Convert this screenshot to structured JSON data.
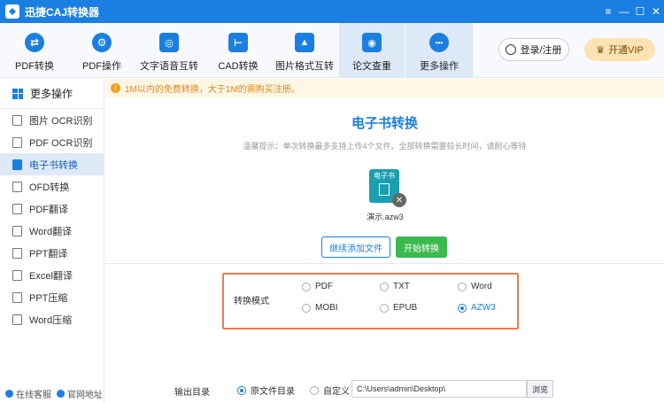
{
  "app": {
    "title": "迅捷CAJ转换器"
  },
  "window_controls": [
    "≡",
    "—",
    "☐",
    "✕"
  ],
  "toolbar": {
    "items": [
      {
        "label": "PDF转换",
        "icon": "pdf-convert-icon",
        "glyph": "⇄"
      },
      {
        "label": "PDF操作",
        "icon": "pdf-operation-icon",
        "glyph": "⚙"
      },
      {
        "label": "文字语音互转",
        "icon": "text-speech-icon",
        "glyph": "◎"
      },
      {
        "label": "CAD转换",
        "icon": "cad-convert-icon",
        "glyph": "⊢"
      },
      {
        "label": "图片格式互转",
        "icon": "image-format-icon",
        "glyph": "▲"
      },
      {
        "label": "论文查重",
        "icon": "paper-check-icon",
        "glyph": "◉"
      },
      {
        "label": "更多操作",
        "icon": "more-ops-icon",
        "glyph": "•••"
      }
    ],
    "active_index": 5,
    "login_label": "登录/注册",
    "vip_label": "开通VIP"
  },
  "sidebar": {
    "header": "更多操作",
    "items": [
      {
        "label": "图片 OCR识别"
      },
      {
        "label": "PDF OCR识别"
      },
      {
        "label": "电子书转换"
      },
      {
        "label": "OFD转换"
      },
      {
        "label": "PDF翻译"
      },
      {
        "label": "Word翻译"
      },
      {
        "label": "PPT翻译"
      },
      {
        "label": "Excel翻译"
      },
      {
        "label": "PPT压缩"
      },
      {
        "label": "Word压缩"
      }
    ],
    "active_index": 2,
    "footer": {
      "service": "在线客服",
      "website": "官网地址"
    }
  },
  "notice": {
    "text": "1M以内的免费转换，大于1M的需购买注册。"
  },
  "main": {
    "title": "电子书转换",
    "tip": "温馨提示：单次转换最多支持上传4个文件。全部转换需要较长时间，请耐心等待",
    "file": {
      "icon_text": "电子书",
      "name": "演示.azw3"
    },
    "add_button": "继续添加文件",
    "start_button": "开始转换",
    "mode_label": "转换模式",
    "mode_options": [
      "PDF",
      "TXT",
      "Word",
      "MOBI",
      "EPUB",
      "AZW3"
    ],
    "mode_selected": "AZW3",
    "output": {
      "label": "输出目录",
      "option_source": "原文件目录",
      "option_custom": "自定义",
      "selected": "原文件目录",
      "path": "C:\\Users\\admin\\Desktop\\",
      "browse": "浏览"
    }
  },
  "colors": {
    "accent": "#1a7fe0",
    "highlight_border": "#f07a4a",
    "start_button": "#3cb94d",
    "notice_text": "#e0871a"
  }
}
